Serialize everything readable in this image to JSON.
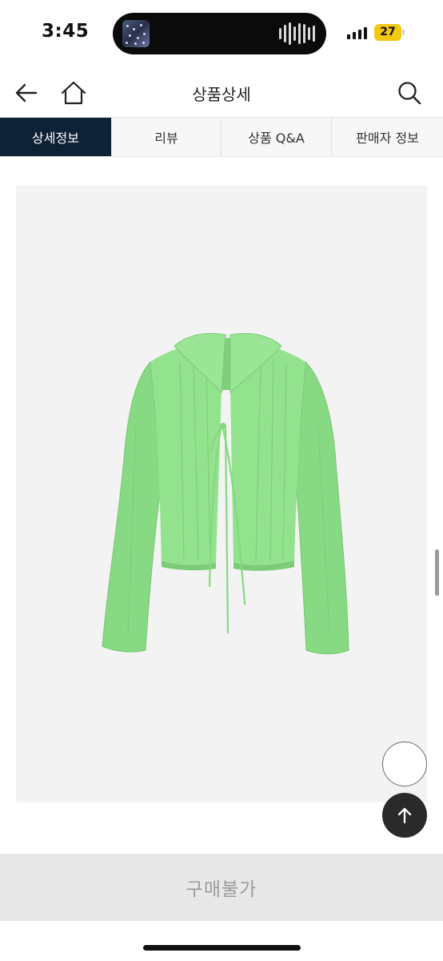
{
  "status_bar": {
    "time": "3:45",
    "battery": "27",
    "signal_bars": 4
  },
  "header": {
    "title": "상품상세",
    "icons": [
      "back-arrow-icon",
      "home-icon",
      "search-icon"
    ]
  },
  "tabs": [
    {
      "label": "상세정보",
      "active": true
    },
    {
      "label": "리뷰",
      "active": false
    },
    {
      "label": "상품 Q&A",
      "active": false
    },
    {
      "label": "판매자 정보",
      "active": false
    }
  ],
  "product": {
    "image_subject": "green-tie-front-cropped-cardigan",
    "background_color": "#f3f3f3",
    "garment_color": "#8fe08a"
  },
  "floating_buttons": {
    "circle_icon": "circle-outline-icon",
    "top_icon": "arrow-up-icon"
  },
  "purchase": {
    "label": "구매불가",
    "disabled": true
  },
  "colors": {
    "active_tab": "#0e2236",
    "battery": "#f2c811",
    "buy_bar": "#e8e8e8"
  }
}
